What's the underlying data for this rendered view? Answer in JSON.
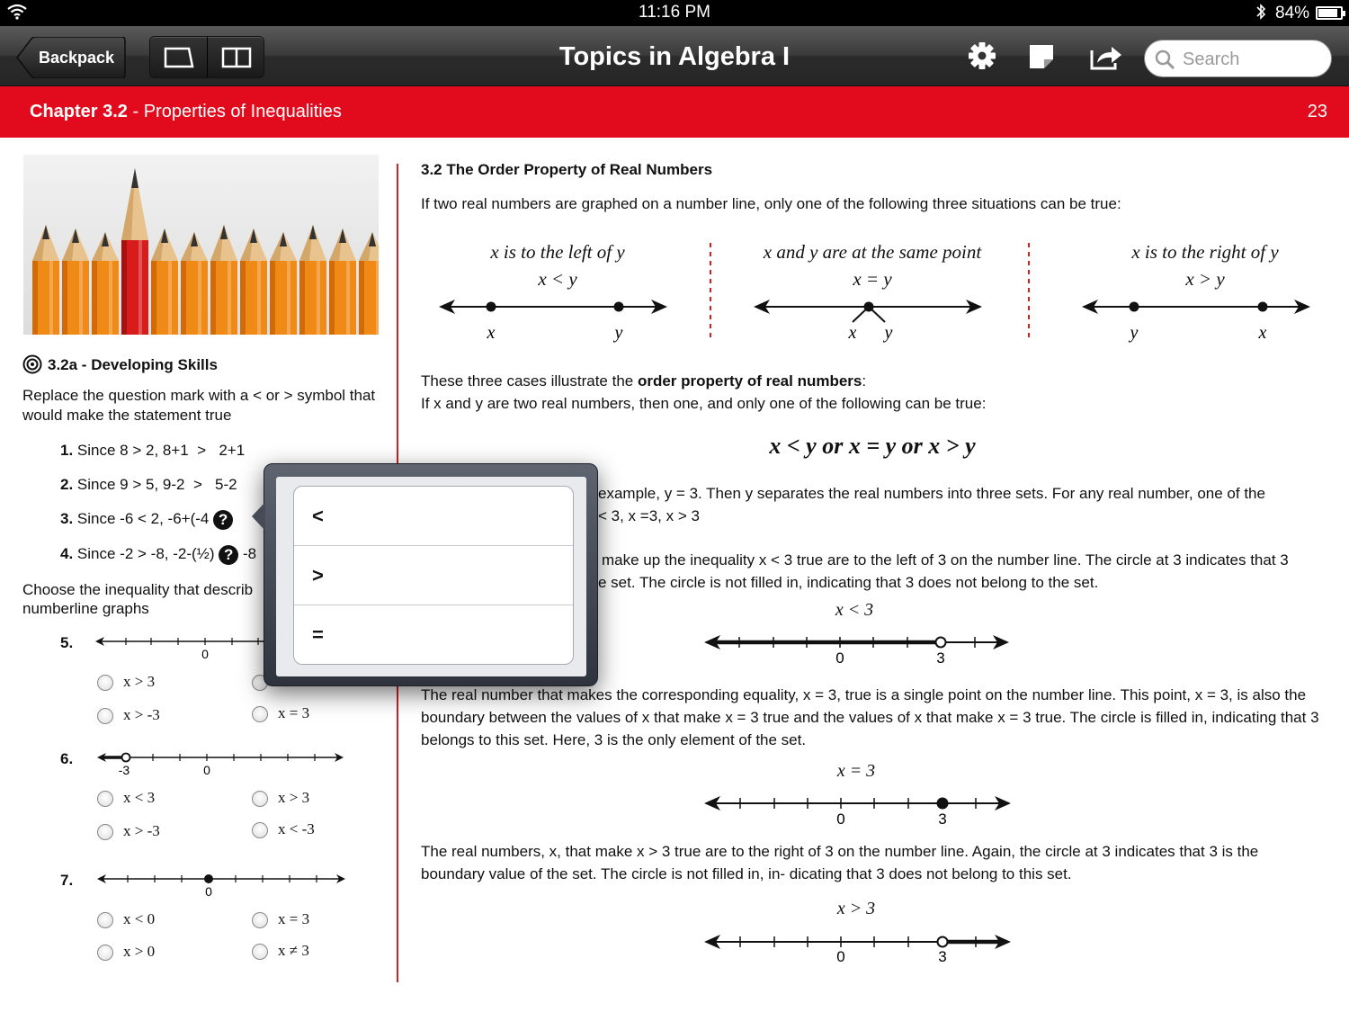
{
  "status_bar": {
    "time": "11:16 PM",
    "battery": "84%"
  },
  "toolbar": {
    "back_label": "Backpack",
    "title": "Topics in Algebra I",
    "search_placeholder": "Search"
  },
  "chapter": {
    "number": "Chapter 3.2",
    "separator": " - ",
    "title": "Properties of Inequalities",
    "page": "23"
  },
  "left": {
    "section_heading": "3.2a - Developing Skills",
    "instructions": "Replace the question mark with a < or > symbol that would make the statement true",
    "problems": [
      {
        "num": "1.",
        "text": "Since 8 > 2, 8+1",
        "answer": ">",
        "rhs": "2+1"
      },
      {
        "num": "2.",
        "text": "Since 9 > 5, 9-2",
        "answer": ">",
        "rhs": "5-2"
      },
      {
        "num": "3.",
        "text": "Since -6 < 2, -6+(-4",
        "answer": "?",
        "rhs": ""
      },
      {
        "num": "4.",
        "text": "Since -2 > -8, -2-(½)",
        "answer": "?",
        "rhs": "-8"
      }
    ],
    "choose_instructions_line1": "Choose the inequality that describ",
    "choose_instructions_line2": "numberline graphs",
    "q5": {
      "num": "5.",
      "tick0": "0",
      "opts": [
        "x > 3",
        "x > -3",
        "x = 3"
      ]
    },
    "q6": {
      "num": "6.",
      "tick_neg3": "-3",
      "tick0": "0",
      "opts": [
        "x < 3",
        "x > -3",
        "x > 3",
        "x < -3"
      ]
    },
    "q7": {
      "num": "7.",
      "tick0": "0",
      "opts": [
        "x < 0",
        "x > 0",
        "x = 3",
        "x ≠ 3"
      ]
    }
  },
  "right": {
    "heading": "3.2 The Order Property of Real Numbers",
    "intro": "If two real numbers are graphed on a number line, only one of the following three situations can be true:",
    "cases": [
      {
        "title": "x is to the left of y",
        "rel": "x < y",
        "a": "x",
        "b": "y"
      },
      {
        "title": "x and y are at the same point",
        "rel": "x = y",
        "a": "x",
        "b": "y"
      },
      {
        "title": "x is to the right of y",
        "rel": "x > y",
        "a": "y",
        "b": "x"
      }
    ],
    "illustrate_pre": "These three cases illustrate the ",
    "illustrate_bold": "order property of real numbers",
    "illustrate_post": ":",
    "if_line": "If x and y are two real numbers, then one, and only one of the following can be true:",
    "formula": "x < y or x = y or x > y",
    "para1_line1": "example, y = 3. Then y separates the real numbers into three sets. For any real number, one of the",
    "para1_line2": "< 3, x =3, x > 3",
    "para2_line1": "make up the inequality x < 3 true are to the left of 3 on the number line. The circle at 3 indicates that 3",
    "para2_line2": "e set. The circle is not filled in, indicating that 3 does not belong to the set.",
    "nl1": {
      "label": "x < 3",
      "t0": "0",
      "t3": "3"
    },
    "para3": "The real number that makes the corresponding equality, x = 3, true is a single point on the number line. This point, x = 3, is also the boundary between the values of x that make x = 3 true and the values of x that make x = 3 true. The circle is filled in, indicating that 3 belongs to this set. Here, 3 is the only element of the set.",
    "nl2": {
      "label": "x = 3",
      "t0": "0",
      "t3": "3"
    },
    "para4": "The real numbers, x, that make x > 3 true are to the right of 3 on the number line. Again, the circle at 3 indicates that 3 is the boundary value of the set. The circle is not filled in, in- dicating that 3 does not belong to this set.",
    "nl3": {
      "label": "x > 3",
      "t0": "0",
      "t3": "3"
    }
  },
  "popover": {
    "options": [
      "<",
      ">",
      "="
    ]
  },
  "colors": {
    "accent_red": "#e20b1d",
    "toolbar": "#3b3b3b"
  }
}
